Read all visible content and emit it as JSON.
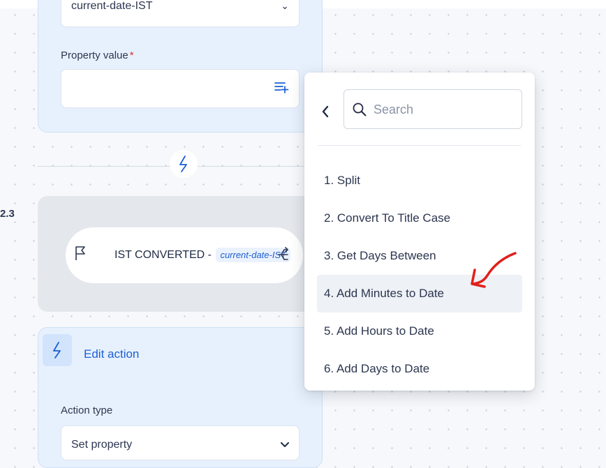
{
  "property_panel": {
    "property_name_value": "current-date-IST",
    "property_value_label": "Property value",
    "required_marker": "*"
  },
  "step": {
    "number": "2.3",
    "title": "IST CONVERTED - ",
    "tag": "current-date-IST"
  },
  "edit_action": {
    "title": "Edit action",
    "action_type_label": "Action type",
    "action_type_value": "Set property"
  },
  "function_menu": {
    "search_placeholder": "Search",
    "items": [
      {
        "label": "1. Split"
      },
      {
        "label": "2. Convert To Title Case"
      },
      {
        "label": "3. Get Days Between"
      },
      {
        "label": "4. Add Minutes to Date"
      },
      {
        "label": "5. Add Hours to Date"
      },
      {
        "label": "6. Add Days to Date"
      }
    ],
    "highlighted_index": 3
  },
  "colors": {
    "accent": "#1c5fd4",
    "panel_bg": "#e7f1fd",
    "annotation": "#e0201b"
  },
  "icons": [
    "add-list-icon",
    "lightning-icon",
    "flag-icon",
    "branch-icon",
    "chevron-left-icon",
    "search-icon",
    "chevron-down-icon"
  ]
}
